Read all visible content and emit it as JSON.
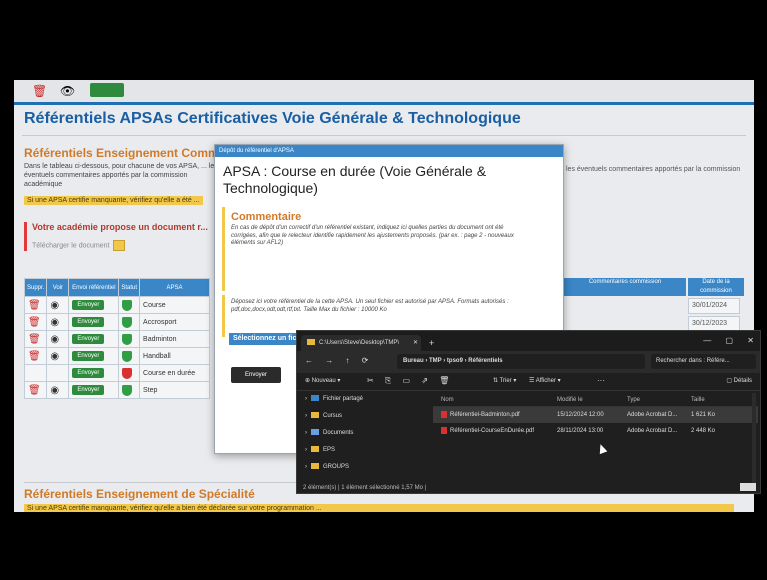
{
  "page": {
    "title": "Référentiels APSAs Certificatives Voie Générale & Technologique",
    "topbar": {
      "delete_icon": "trash-icon",
      "view_icon": "eye-icon"
    }
  },
  "section1": {
    "heading": "Référentiels Enseignement Commun",
    "text": "Dans le tableau ci-dessous, pour chacune de vos APSA, ... les éventuels commentaires apportés par la commission académique",
    "highlight": "Si une APSA certifie manquante, vérifiez qu'elle a été ...",
    "right_note": "les éventuels commentaires apportés par la commission"
  },
  "academie": {
    "title": "Votre académie propose un document r...",
    "download_label": "Télécharger le document"
  },
  "table": {
    "headers": [
      "Suppr.",
      "Voir",
      "Envoi référentiel",
      "Statut",
      "APSA"
    ],
    "right_headers": [
      "Commentaires commission",
      "Date de la commission"
    ],
    "send_label": "Envoyer",
    "rows": [
      {
        "apsa": "Course",
        "status": "ok",
        "date": "30/01/2024",
        "has_actions": true
      },
      {
        "apsa": "Accrosport",
        "status": "ok",
        "date": "30/12/2023",
        "has_actions": true
      },
      {
        "apsa": "Badminton",
        "status": "ok",
        "date": "",
        "has_actions": true
      },
      {
        "apsa": "Handball",
        "status": "ok",
        "date": "",
        "has_actions": true
      },
      {
        "apsa": "Course en durée",
        "status": "missing",
        "date": "",
        "has_actions": false
      },
      {
        "apsa": "Step",
        "status": "ok",
        "date": "",
        "has_actions": true
      }
    ]
  },
  "section2": {
    "heading": "Référentiels Enseignement de Spécialité",
    "highlight": "Si une APSA certifie manquante, vérifiez qu'elle a bien été déclarée sur votre programmation ..."
  },
  "modal": {
    "bar_title": "Dépôt du référentiel d'APSA",
    "title": "APSA : Course en durée (Voie Générale & Technologique)",
    "comment_title": "Commentaire",
    "comment_text": "En cas de dépôt d'un correctif d'un référentiel existant, indiquez ici quelles parties du document ont été corrigées, afin que le relecteur identifie rapidement les ajustements proposés. (par ex. : page 2 - nouveaux éléments sur AFL2)",
    "deposit_text": "Déposez ici votre référentiel de la cette APSA. Un seul fichier est autorisé par APSA. Formats autorisés : pdf,doc,docx,odt,odt,rtf,txt. Taille Max du fichier : 10000 Ko",
    "select_label": "Sélectionnez un fichier",
    "send_label": "Envoyer"
  },
  "explorer": {
    "tab_title": "C:\\Users\\Steve\\Desktop\\TMP\\",
    "path": [
      "Bureau",
      "TMP",
      "tpso9",
      "Référentiels"
    ],
    "search_placeholder": "Rechercher dans : Référe...",
    "new_label": "Nouveau",
    "sort_label": "Trier",
    "view_label": "Afficher",
    "details_label": "Détails",
    "sidebar": [
      {
        "label": "Fichier partagé",
        "color": "#3a86c7"
      },
      {
        "label": "Cursus",
        "color": "#e8b93a"
      },
      {
        "label": "Documents",
        "color": "#6aa0e0"
      },
      {
        "label": "EPS",
        "color": "#e8b93a"
      },
      {
        "label": "GROUPS",
        "color": "#e8b93a"
      }
    ],
    "columns": [
      "Nom",
      "Modifié le",
      "Type",
      "Taille"
    ],
    "files": [
      {
        "name": "Référentiel-Badminton.pdf",
        "date": "15/12/2024 12:00",
        "type": "Adobe Acrobat D...",
        "size": "1 621 Ko",
        "selected": true
      },
      {
        "name": "Référentiel-CourseEnDurée.pdf",
        "date": "28/11/2024 13:00",
        "type": "Adobe Acrobat D...",
        "size": "2 448 Ko",
        "selected": false
      }
    ],
    "status": "2 élément(s) | 1 élément sélectionné 1,57 Mo |"
  }
}
